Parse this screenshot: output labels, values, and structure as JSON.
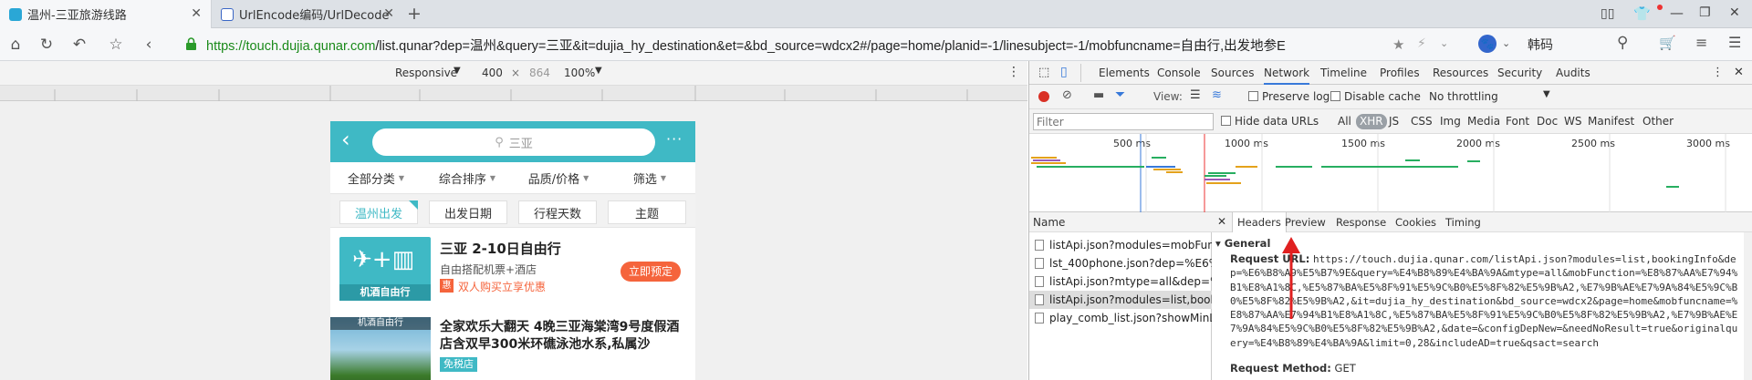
{
  "browser": {
    "tabs": [
      {
        "title": "温州-三亚旅游线路",
        "active": true
      },
      {
        "title": "UrlEncode编码/UrlDecode解",
        "active": false
      }
    ],
    "new_tab": "+",
    "url_prefix": "https://",
    "url_host": "touch.dujia.qunar.com",
    "url_rest": "/list.qunar?dep=温州&query=三亚&it=dujia_hy_destination&et=&bd_source=wdcx2#/page=home/planid=-1/linesubject=-1/mobfuncname=自由行,出发地参E",
    "search_label": "韩码",
    "window_controls": [
      "▭",
      "—",
      "❐",
      "✕"
    ]
  },
  "emulation": {
    "device": "Responsive",
    "width": "400",
    "times": "×",
    "height": "864",
    "zoom": "100%"
  },
  "phone": {
    "search_placeholder": "三亚",
    "filters": [
      "全部分类",
      "综合排序",
      "品质/价格",
      "筛选"
    ],
    "chips": [
      "温州出发",
      "出发日期",
      "行程天数",
      "主题"
    ],
    "products": [
      {
        "title": "三亚 2-10日自由行",
        "subtitle": "自由搭配机票+酒店",
        "badge": "惠",
        "promo": "双人购买立享优惠",
        "button": "立即预定",
        "image_label": "机酒自由行"
      },
      {
        "title": "全家欢乐大翻天 4晚三亚海棠湾9号度假酒店含双早300米环礁泳池水系,私属沙",
        "tag": "免税店",
        "image_label": "机酒自由行"
      }
    ],
    "colors": {
      "accent": "#3fb9c5",
      "orange": "#f5643c"
    }
  },
  "devtools": {
    "tabs": [
      "Elements",
      "Console",
      "Sources",
      "Network",
      "Timeline",
      "Profiles",
      "Resources",
      "Security",
      "Audits"
    ],
    "active_tab": "Network",
    "view_label": "View:",
    "preserve_log": "Preserve log",
    "disable_cache": "Disable cache",
    "throttling": "No throttling",
    "filter_placeholder": "Filter",
    "hide_data_urls": "Hide data URLs",
    "filter_types": [
      "All",
      "XHR",
      "JS",
      "CSS",
      "Img",
      "Media",
      "Font",
      "Doc",
      "WS",
      "Manifest",
      "Other"
    ],
    "active_filter": "XHR",
    "timeline_ticks": [
      "500 ms",
      "1000 ms",
      "1500 ms",
      "2000 ms",
      "2500 ms",
      "3000 ms"
    ],
    "name_header": "Name",
    "requests": [
      "listApi.json?modules=mobFun...",
      "lst_400phone.json?dep=%E6%B...",
      "listApi.json?mtype=all&dep=%...",
      "listApi.json?modules=list,book...",
      "play_comb_list.json?showMinL..."
    ],
    "selected_request": 3,
    "detail_tabs": [
      "Headers",
      "Preview",
      "Response",
      "Cookies",
      "Timing"
    ],
    "section": "General",
    "request_url_label": "Request URL:",
    "request_url": "https://touch.dujia.qunar.com/listApi.json?modules=list,bookingInfo&dep=%E6%B8%A9%E5%B7%9E&query=%E4%B8%89%E4%BA%9A&mtype=all&mobFunction=%E8%87%AA%E7%94%B1%E8%A1%8C,%E5%87%BA%E5%8F%91%E5%9C%B0%E5%8F%82%E5%9B%A2,%E7%9B%AE%E7%9A%84%E5%9C%B0%E5%8F%82%E5%9B%A2,&it=dujia_hy_destination&bd_source=wdcx2&page=home&mobfuncname=%E8%87%AA%E7%94%B1%E8%A1%8C,%E5%87%BA%E5%8F%91%E5%9C%B0%E5%8F%82%E5%9B%A2,%E7%9B%AE%E7%9A%84%E5%9C%B0%E5%8F%82%E5%9B%A2,&date=&configDepNew=&needNoResult=true&originalquery=%E4%B8%89%E4%BA%9A&limit=0,28&includeAD=true&qsact=search",
    "request_method_label": "Request Method:",
    "request_method": "GET"
  }
}
